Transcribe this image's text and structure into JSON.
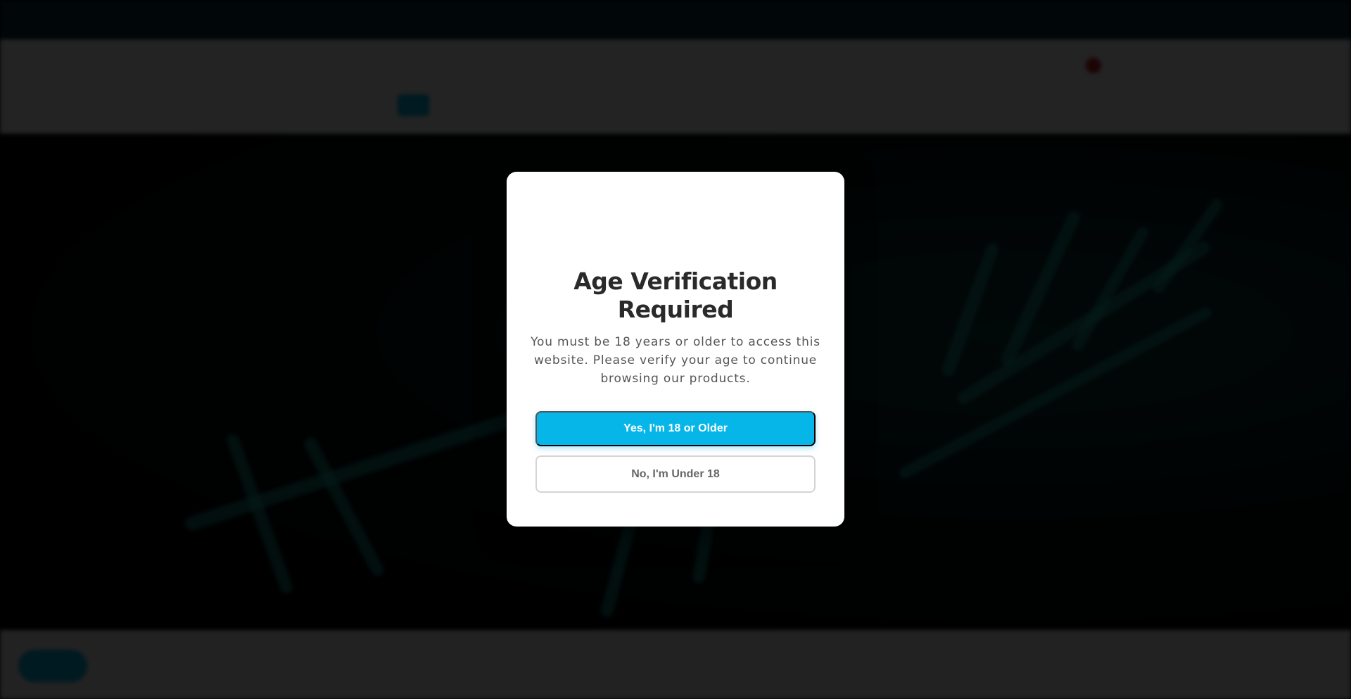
{
  "modal": {
    "title": "Age Verification Required",
    "message": "You must be 18 years or older to access this website. Please verify your age to continue browsing our products.",
    "confirm_label": "Yes, I'm 18 or Older",
    "deny_label": "No, I'm Under 18"
  },
  "colors": {
    "accent": "#06b6e8",
    "overlay": "rgba(0,0,0,0.86)",
    "modal_bg": "#ffffff",
    "title_text": "#2a2a2a",
    "body_text": "#555555"
  },
  "icons": {
    "cart": "cart-icon",
    "chat": "chat-icon"
  }
}
